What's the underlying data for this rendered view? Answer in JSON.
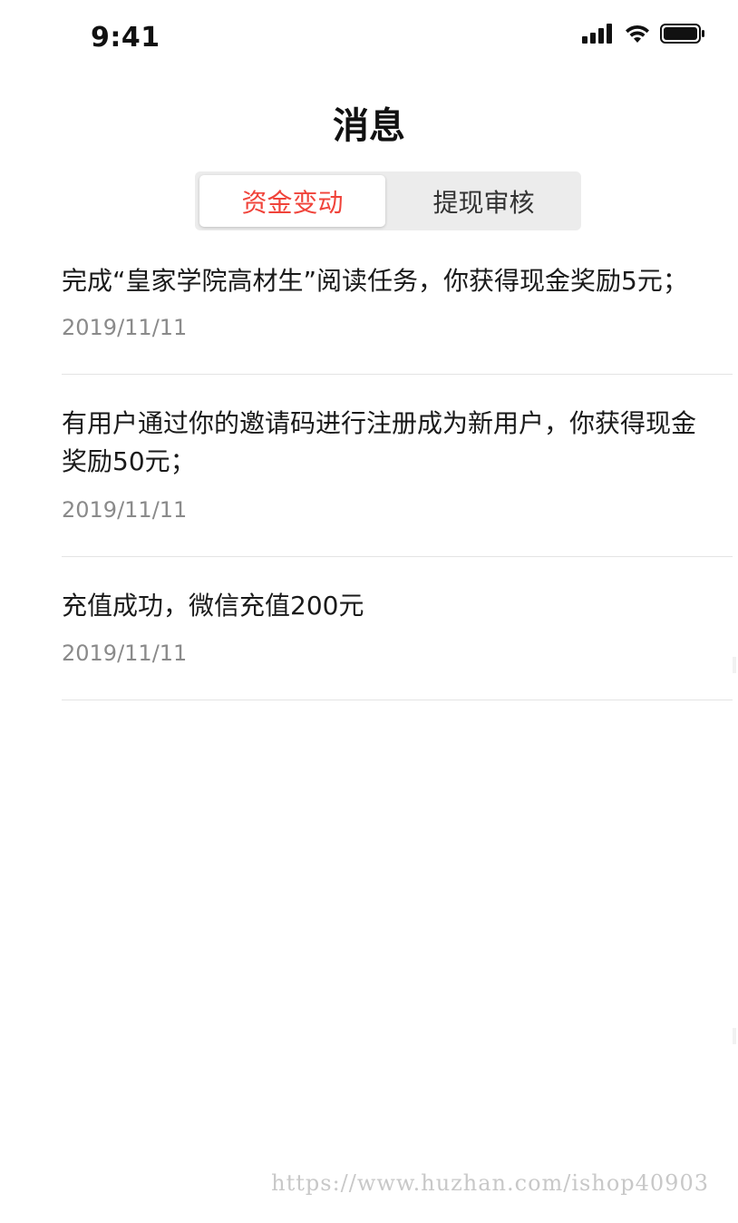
{
  "status_bar": {
    "time": "9:41",
    "icons": [
      "signal-icon",
      "wifi-icon",
      "battery-icon"
    ]
  },
  "header": {
    "title": "消息"
  },
  "tabs": [
    {
      "label": "资金变动",
      "active": true
    },
    {
      "label": "提现审核",
      "active": false
    }
  ],
  "colors": {
    "accent": "#f0433a",
    "date_text": "#8a8a8a",
    "divider": "#e4e4e4",
    "segment_bg": "#ececec"
  },
  "messages": [
    {
      "text": "完成“皇家学院高材生”阅读任务，你获得现金奖励5元；",
      "date": "2019/11/11"
    },
    {
      "text": "有用户通过你的邀请码进行注册成为新用户，你获得现金奖励50元；",
      "date": "2019/11/11"
    },
    {
      "text": "充值成功，微信充值200元",
      "date": "2019/11/11"
    }
  ],
  "watermark": "https://www.huzhan.com/ishop40903"
}
